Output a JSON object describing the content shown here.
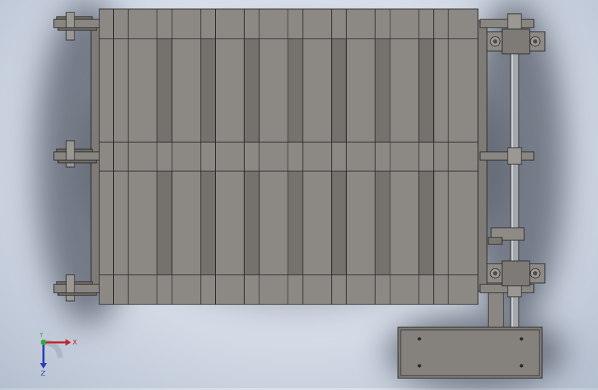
{
  "window": {
    "title": ""
  },
  "scene": {
    "view": "top",
    "background_top": "#e9eef6",
    "background_bottom": "#b4bfcf",
    "part_color": "#8c8984",
    "gap_color": "#75716c",
    "edge_color": "#2a2a2a",
    "shaft_color": "#a5a8ad",
    "slat_count": 8
  },
  "triad": {
    "x_label": "X",
    "y_label": "Y",
    "z_label": "Z",
    "x_color": "#c0282d",
    "y_color": "#33a83a",
    "z_color": "#2b3db8"
  }
}
